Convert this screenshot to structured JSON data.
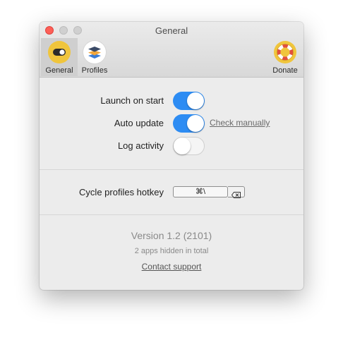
{
  "window": {
    "title": "General"
  },
  "toolbar": {
    "tabs": [
      {
        "label": "General",
        "icon": "toggle-icon",
        "active": true
      },
      {
        "label": "Profiles",
        "icon": "layers-icon",
        "active": false
      }
    ],
    "donate": {
      "label": "Donate",
      "icon": "lifebuoy-icon"
    }
  },
  "settings": {
    "launch_on_start": {
      "label": "Launch on start",
      "enabled": true
    },
    "auto_update": {
      "label": "Auto update",
      "enabled": true,
      "link": "Check manually"
    },
    "log_activity": {
      "label": "Log activity",
      "enabled": false
    }
  },
  "hotkey": {
    "label": "Cycle profiles hotkey",
    "value": "⌘\\",
    "clear_icon": "clear-icon"
  },
  "footer": {
    "version": "Version 1.2 (2101)",
    "hidden_apps": "2 apps hidden in total",
    "support_link": "Contact support"
  },
  "colors": {
    "accent": "#2d8cf3",
    "icon_yellow": "#f0c53c",
    "close": "#fd5f57"
  }
}
